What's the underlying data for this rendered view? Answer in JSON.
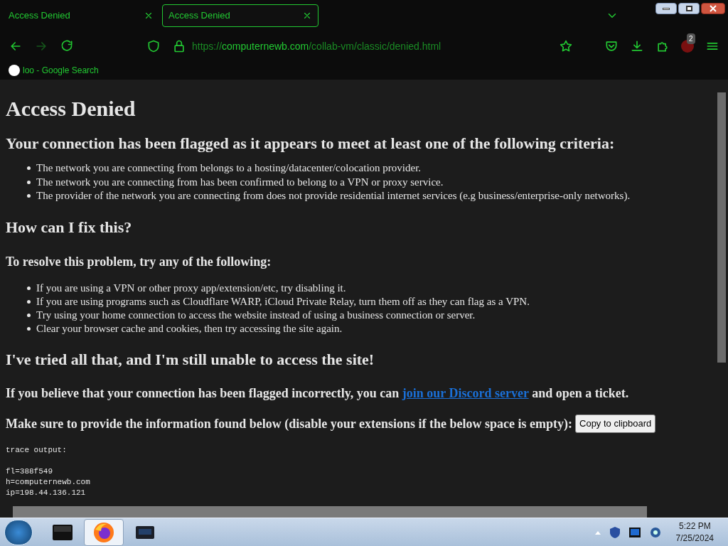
{
  "tabs": [
    {
      "title": "Access Denied",
      "selected": false
    },
    {
      "title": "Access Denied",
      "selected": true
    }
  ],
  "address": {
    "scheme": "https://",
    "host": "computernewb.com",
    "path": "/collab-vm/classic/denied.html"
  },
  "extension_badge": "2",
  "bookmarks": [
    {
      "label": "loo - Google Search"
    }
  ],
  "page": {
    "title": "Access Denied",
    "criteria_heading": "Your connection has been flagged as it appears to meet at least one of the following criteria:",
    "criteria": [
      "The network you are connecting from belongs to a hosting/datacenter/colocation provider.",
      "The network you are connecting from has been confirmed to belong to a VPN or proxy service.",
      "The provider of the network you are connecting from does not provide residential internet services (e.g business/enterprise-only networks)."
    ],
    "fix_heading": "How can I fix this?",
    "fix_intro": "To resolve this problem, try any of the following:",
    "fixes": [
      "If you are using a VPN or other proxy app/extension/etc, try disabling it.",
      "If you are using programs such as Cloudflare WARP, iCloud Private Relay, turn them off as they can flag as a VPN.",
      "Try using your home connection to access the website instead of using a business connection or server.",
      "Clear your browser cache and cookies, then try accessing the site again."
    ],
    "still_heading": "I've tried all that, and I'm still unable to access the site!",
    "contact_before": "If you believe that your connection has been flagged incorrectly, you can",
    "contact_link": "join our Discord server",
    "contact_after": "and open a ticket.",
    "provide_text": "Make sure to provide the information found below (disable your extensions if the below space is empty):",
    "copy_button": "Copy to clipboard",
    "trace_label": "trace output:",
    "trace": [
      "fl=388f549",
      "h=computernewb.com",
      "ip=198.44.136.121"
    ]
  },
  "taskbar": {
    "items": [
      {
        "kind": "terminal",
        "selected": false
      },
      {
        "kind": "firefox",
        "selected": true
      },
      {
        "kind": "display",
        "selected": false
      }
    ],
    "time": "5:22 PM",
    "date": "7/25/2024"
  }
}
